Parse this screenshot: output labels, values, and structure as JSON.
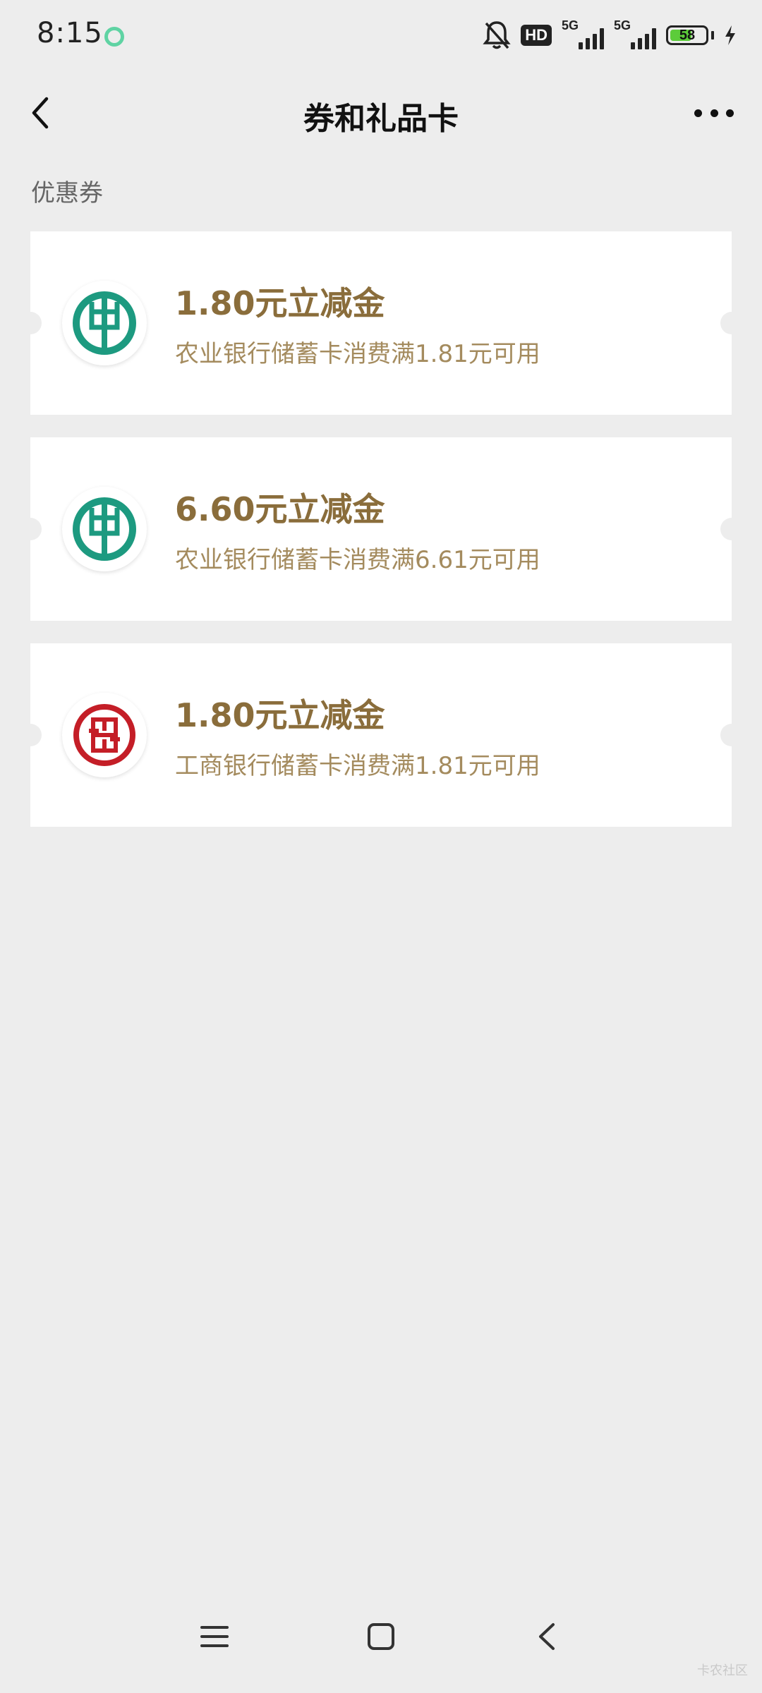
{
  "status_bar": {
    "time": "8:15",
    "hd_label": "HD",
    "network_1": "5G",
    "network_2": "5G",
    "battery": "58"
  },
  "header": {
    "title": "券和礼品卡"
  },
  "section": {
    "label": "优惠券"
  },
  "coupons": [
    {
      "title": "1.80元立减金",
      "description": "农业银行储蓄卡消费满1.81元可用",
      "bank_icon": "abc-bank-logo-icon"
    },
    {
      "title": "6.60元立减金",
      "description": "农业银行储蓄卡消费满6.61元可用",
      "bank_icon": "abc-bank-logo-icon"
    },
    {
      "title": "1.80元立减金",
      "description": "工商银行储蓄卡消费满1.81元可用",
      "bank_icon": "icbc-bank-logo-icon"
    }
  ],
  "watermark": "卡农社区",
  "colors": {
    "background": "#ededed",
    "coupon_title": "#8a6d3b",
    "coupon_desc": "#a48b5e",
    "abc_green": "#1d9a80",
    "icbc_red": "#c41e27"
  }
}
